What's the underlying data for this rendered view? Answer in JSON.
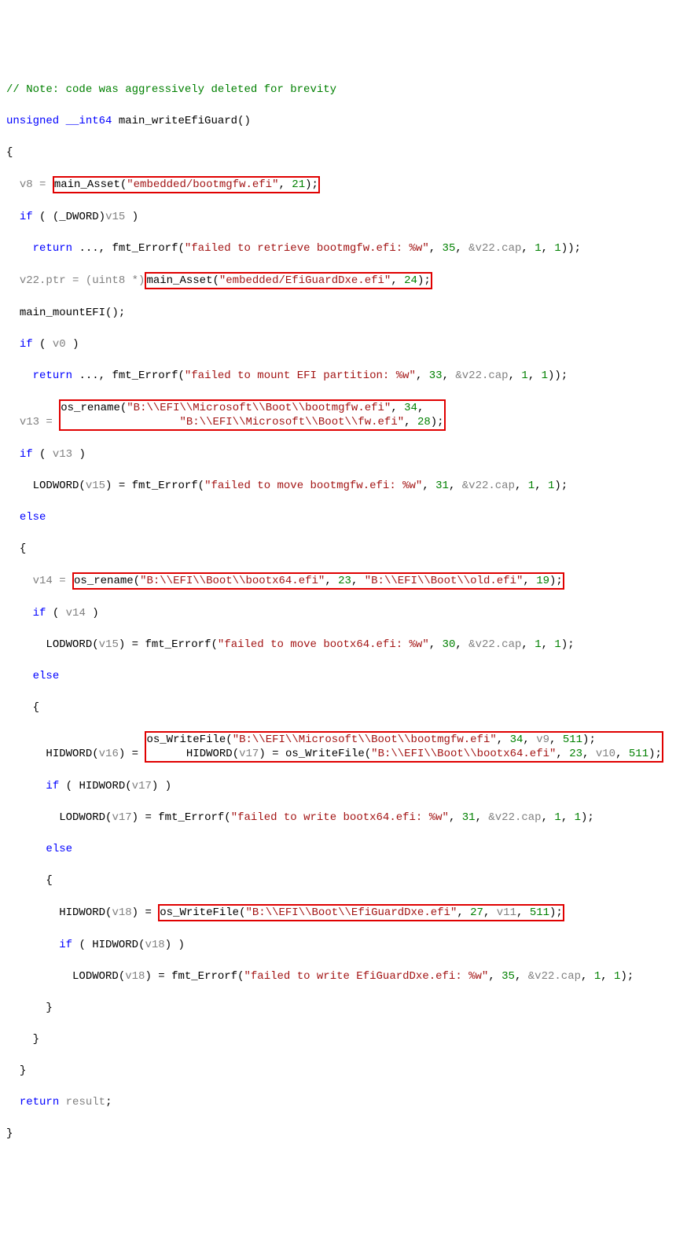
{
  "c": {
    "note": "// Note: code was aggressively deleted for brevity",
    "sig_kw": "unsigned",
    "sig_type": "__int64",
    "sig_fn": "main_writeEfiGuard",
    "v8_lhs": "v8 = ",
    "v8_call_fn": "main_Asset",
    "v8_s1": "\"embedded/bootmgfw.efi\"",
    "v8_n1": "21",
    "if": "if",
    "else": "else",
    "ret": "return",
    "dword_cast": "(_DWORD)",
    "v15": "v15",
    "ret1_fn": "fmt_Errorf",
    "ret1_s": "\"failed to retrieve bootmgfw.efi: %w\"",
    "ret1_n1": "35",
    "ret1_v": "&v22.cap",
    "ret1_n2": "1",
    "ret1_n3": "1",
    "v22ptr_lhs": "v22.ptr = (uint8 *)",
    "v22ptr_fn": "main_Asset",
    "v22ptr_s": "\"embedded/EfiGuardDxe.efi\"",
    "v22ptr_n": "24",
    "mount_fn": "main_mountEFI",
    "v0": "v0",
    "ret2_s": "\"failed to mount EFI partition: %w\"",
    "ret2_n1": "33",
    "v13_lhs": "v13 = ",
    "os_rename": "os_rename",
    "v13_s1": "\"B:\\\\EFI\\\\Microsoft\\\\Boot\\\\bootmgfw.efi\"",
    "v13_n1": "34",
    "v13_s2": "\"B:\\\\EFI\\\\Microsoft\\\\Boot\\\\fw.efi\"",
    "v13_n2": "28",
    "v13": "v13",
    "lodword": "LODWORD",
    "hidword": "HIDWORD",
    "err_move_bootmgfw": "\"failed to move bootmgfw.efi: %w\"",
    "n31": "31",
    "v14_lhs": "v14 = ",
    "v14_s1": "\"B:\\\\EFI\\\\Boot\\\\bootx64.efi\"",
    "v14_n1": "23",
    "v14_s2": "\"B:\\\\EFI\\\\Boot\\\\old.efi\"",
    "v14_n2": "19",
    "v14": "v14",
    "err_move_bootx64": "\"failed to move bootx64.efi: %w\"",
    "n30": "30",
    "v16": "v16",
    "v17": "v17",
    "v18": "v18",
    "os_writefile": "os_WriteFile",
    "wf1_s": "\"B:\\\\EFI\\\\Microsoft\\\\Boot\\\\bootmgfw.efi\"",
    "wf1_n": "34",
    "wf1_v": "v9",
    "wf1_p": "511",
    "wf2_s": "\"B:\\\\EFI\\\\Boot\\\\bootx64.efi\"",
    "wf2_n": "23",
    "wf2_v": "v10",
    "wf2_p": "511",
    "err_write_bootx64": "\"failed to write bootx64.efi: %w\"",
    "wf3_s": "\"B:\\\\EFI\\\\Boot\\\\EfiGuardDxe.efi\"",
    "wf3_n": "27",
    "wf3_v": "v11",
    "wf3_p": "511",
    "err_write_efiguard": "\"failed to write EfiGuardDxe.efi: %w\"",
    "n35": "35",
    "ret_res": "return",
    "result": "result"
  }
}
